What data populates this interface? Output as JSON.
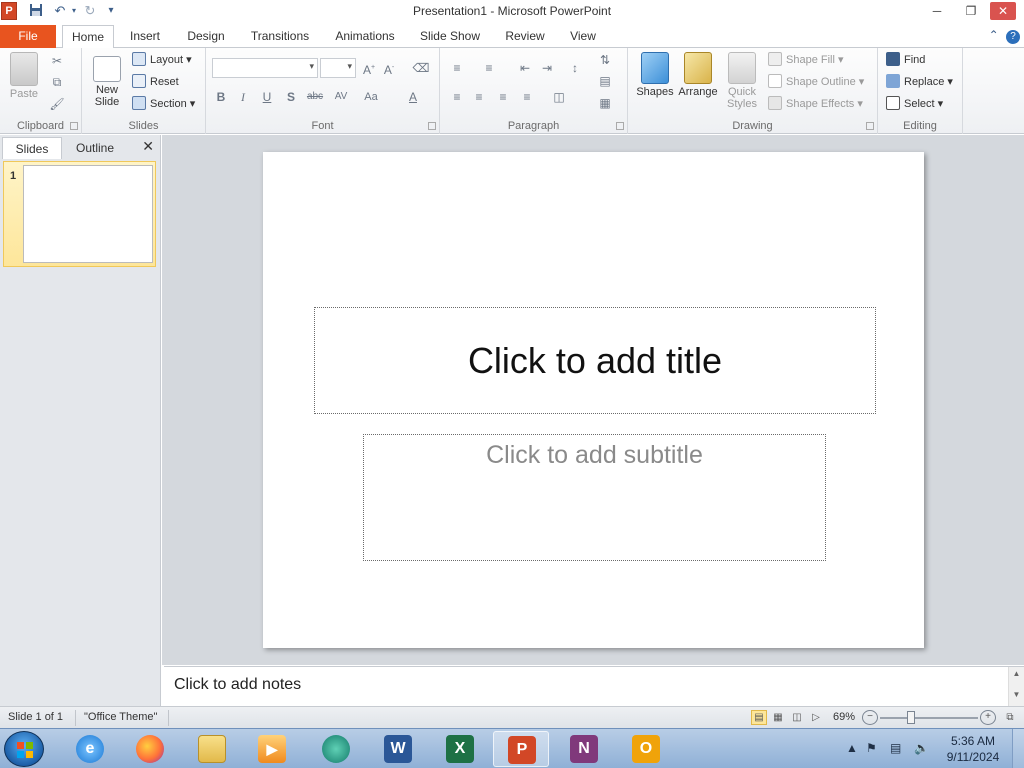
{
  "window": {
    "title": "Presentation1  -  Microsoft PowerPoint",
    "app_icon_letter": "P"
  },
  "tabs": {
    "file": "File",
    "items": [
      "Home",
      "Insert",
      "Design",
      "Transitions",
      "Animations",
      "Slide Show",
      "Review",
      "View"
    ],
    "active": "Home"
  },
  "ribbon": {
    "clipboard": {
      "label": "Clipboard",
      "paste": "Paste"
    },
    "slides": {
      "label": "Slides",
      "new_slide_line1": "New",
      "new_slide_line2": "Slide",
      "layout": "Layout",
      "reset": "Reset",
      "section": "Section"
    },
    "font": {
      "label": "Font",
      "font_name": "",
      "font_size": ""
    },
    "paragraph": {
      "label": "Paragraph"
    },
    "drawing": {
      "label": "Drawing",
      "shapes": "Shapes",
      "arrange": "Arrange",
      "quick_line1": "Quick",
      "quick_line2": "Styles",
      "shape_fill": "Shape Fill",
      "shape_outline": "Shape Outline",
      "shape_effects": "Shape Effects"
    },
    "editing": {
      "label": "Editing",
      "find": "Find",
      "replace": "Replace",
      "select": "Select"
    }
  },
  "panel": {
    "tab_slides": "Slides",
    "tab_outline": "Outline",
    "thumb_number": "1"
  },
  "slide": {
    "title_placeholder": "Click to add title",
    "subtitle_placeholder": "Click to add subtitle"
  },
  "notes": {
    "placeholder": "Click to add notes"
  },
  "status": {
    "slide_count": "Slide 1 of 1",
    "theme": "\"Office Theme\"",
    "zoom": "69%"
  },
  "clock": {
    "time": "5:36 AM",
    "date": "9/11/2024"
  },
  "colors": {
    "file_tab": "#e8541f",
    "powerpoint": "#d24726",
    "word": "#2b5797",
    "excel": "#1e7145",
    "onenote": "#80397b",
    "outlook": "#f0a30a"
  }
}
